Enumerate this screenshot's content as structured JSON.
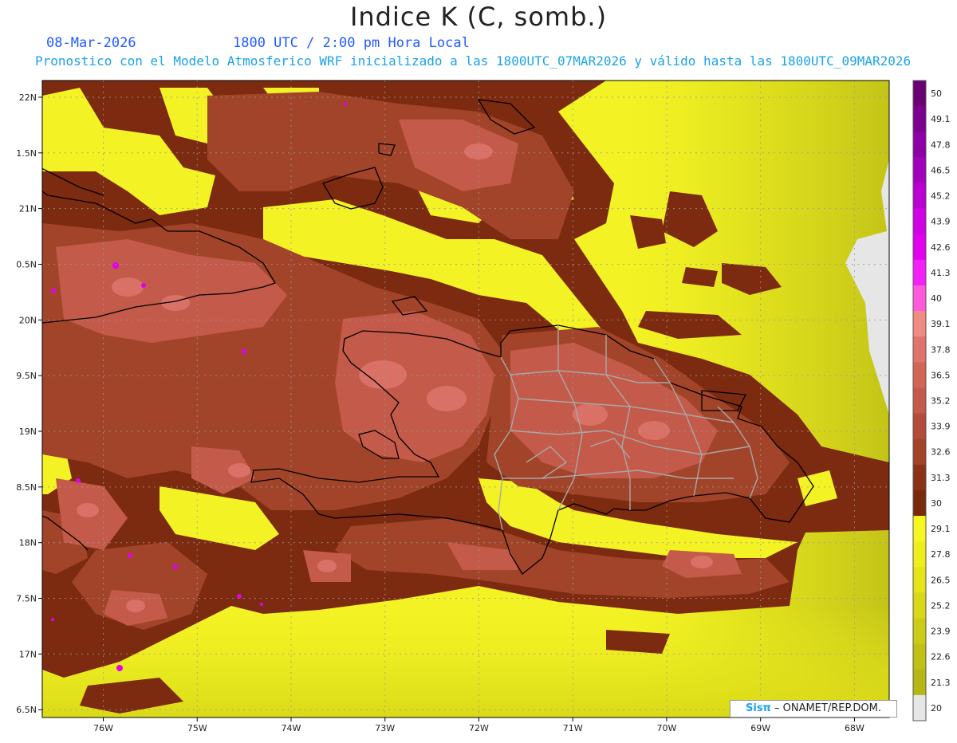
{
  "title": "Indice K (C, somb.)",
  "date": "08-Mar-2026",
  "time": "1800 UTC / 2:00 pm Hora Local",
  "description": "Pronostico con el Modelo Atmosferico WRF inicializado a las 1800UTC_07MAR2026 y válido hasta las  1800UTC_09MAR2026",
  "credit": {
    "brand": "Sisπ",
    "text": " – ONAMET/REP.DOM."
  },
  "map": {
    "lon_range": [
      -76.65,
      -67.63
    ],
    "lat_range": [
      16.43,
      22.15
    ],
    "lon_ticks": [
      {
        "v": -76,
        "label": "76W"
      },
      {
        "v": -75,
        "label": "75W"
      },
      {
        "v": -74,
        "label": "74W"
      },
      {
        "v": -73,
        "label": "73W"
      },
      {
        "v": -72,
        "label": "72W"
      },
      {
        "v": -71,
        "label": "71W"
      },
      {
        "v": -70,
        "label": "70W"
      },
      {
        "v": -69,
        "label": "69W"
      },
      {
        "v": -68,
        "label": "68W"
      }
    ],
    "lat_ticks": [
      {
        "v": 22,
        "label": "22N"
      },
      {
        "v": 21.5,
        "label": "1.5N"
      },
      {
        "v": 21,
        "label": "21N"
      },
      {
        "v": 20.5,
        "label": "0.5N"
      },
      {
        "v": 20,
        "label": "20N"
      },
      {
        "v": 19.5,
        "label": "9.5N"
      },
      {
        "v": 19,
        "label": "19N"
      },
      {
        "v": 18.5,
        "label": "8.5N"
      },
      {
        "v": 18,
        "label": "18N"
      },
      {
        "v": 17.5,
        "label": "7.5N"
      },
      {
        "v": 17,
        "label": "17N"
      },
      {
        "v": 16.5,
        "label": "6.5N"
      }
    ],
    "colors": {
      "yellow": "#f2f224",
      "brown_dark": "#7c2a10",
      "brown_mid": "#a2442a",
      "salmon": "#c45a4a",
      "light_salmon": "#d97166",
      "coast": "#000000",
      "provinces": "#a8a8a8"
    }
  },
  "colorbar": {
    "levels": [
      "50",
      "49.1",
      "47.8",
      "46.5",
      "45.2",
      "43.9",
      "42.6",
      "41.3",
      "40",
      "39.1",
      "37.8",
      "36.5",
      "35.2",
      "33.9",
      "32.6",
      "31.3",
      "30",
      "29.1",
      "27.8",
      "26.5",
      "25.2",
      "23.9",
      "22.6",
      "21.3",
      "20"
    ],
    "colors": [
      "#6a0072",
      "#7c008e",
      "#8e00a6",
      "#a300bd",
      "#bb00d2",
      "#d100e6",
      "#e200f1",
      "#f321f7",
      "#ff5adc",
      "#f08b84",
      "#e0746c",
      "#d36557",
      "#c45a4a",
      "#b44c3c",
      "#a2442a",
      "#8c3218",
      "#7a2a0c",
      "#f6f620",
      "#eeee1c",
      "#e4e418",
      "#d8d818",
      "#cccc16",
      "#c0c016",
      "#b6b614",
      "#e6e6e6"
    ]
  }
}
